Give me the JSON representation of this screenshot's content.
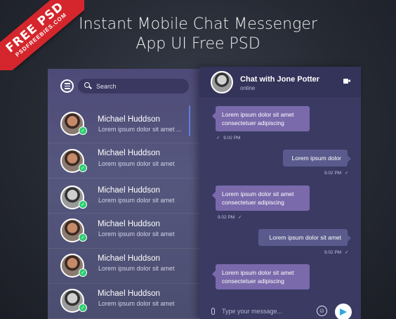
{
  "banner": {
    "ribbon_main": "FREE PSD",
    "ribbon_sub": "PSDFREEBIES.COM",
    "title_line1": "Instant Mobile Chat Messenger",
    "title_line2": "App UI Free PSD"
  },
  "sidebar": {
    "search_placeholder": "Search",
    "contacts": [
      {
        "name": "Michael Huddson",
        "preview": "Lorem ipsum dolor sit amet ...",
        "online_icon": "check-icon"
      },
      {
        "name": "Michael Huddson",
        "preview": "Lorem ipsum dolor sit amet",
        "online_icon": "check-icon"
      },
      {
        "name": "Michael Huddson",
        "preview": "Lorem ipsum dolor sit amet",
        "online_icon": "check-icon"
      },
      {
        "name": "Michael Huddson",
        "preview": "Lorem ipsum dolor sit amet",
        "online_icon": "check-icon"
      },
      {
        "name": "Michael Huddson",
        "preview": "Lorem ipsum dolor sit amet",
        "online_icon": "check-icon"
      },
      {
        "name": "Michael Huddson",
        "preview": "Lorem ipsum dolor sit amet",
        "online_icon": "check-icon"
      }
    ]
  },
  "chat": {
    "title": "Chat with Jone Potter",
    "status": "online",
    "messages": [
      {
        "direction": "in",
        "line1": "Lorem ipsum dolor sit amet",
        "line2": "consectetuer adipiscing",
        "time": "9.02 PM",
        "tick": "✓"
      },
      {
        "direction": "out",
        "line1": "Lorem ipsum dolor",
        "line2": "",
        "time": "9.02 PM",
        "tick": "✓"
      },
      {
        "direction": "in",
        "line1": "Lorem ipsum dolor sit amet",
        "line2": "consectetuer adipiscing",
        "time": "9.02 PM",
        "tick": "✓"
      },
      {
        "direction": "out",
        "line1": "Lorem ipsum dolor sit amet",
        "line2": "",
        "time": "9.02 PM",
        "tick": "✓"
      },
      {
        "direction": "in",
        "line1": "Lorem ipsum dolor sit amet",
        "line2": "consectetuer adipiscing",
        "time": "",
        "tick": ""
      }
    ],
    "composer_placeholder": "Type your message...",
    "emoji_glyph": "☺"
  },
  "colors": {
    "accent": "#7a6aab",
    "online": "#2ecc71",
    "ribbon": "#d4262c",
    "send": "#2fa6e0"
  }
}
